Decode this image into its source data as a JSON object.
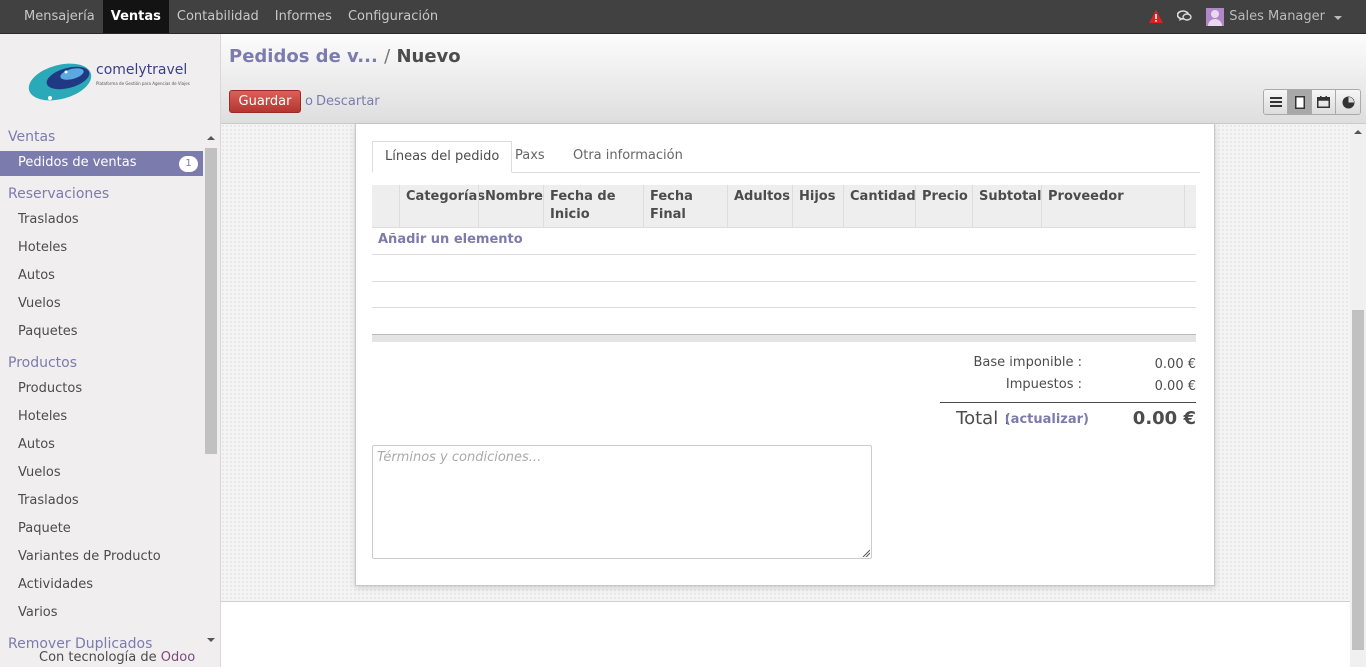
{
  "topbar": {
    "menu": [
      "Mensajería",
      "Ventas",
      "Contabilidad",
      "Informes",
      "Configuración"
    ],
    "active_index": 1,
    "user": "Sales Manager"
  },
  "sidebar": {
    "logo_title": "comelytravel",
    "logo_subtitle": "Plataforma de Gestión para Agencias de Viajes",
    "sections": [
      {
        "label": "Ventas",
        "items": [
          {
            "label": "Pedidos de ventas",
            "badge": "1",
            "active": true
          }
        ]
      },
      {
        "label": "Reservaciones",
        "items": [
          "Traslados",
          "Hoteles",
          "Autos",
          "Vuelos",
          "Paquetes"
        ]
      },
      {
        "label": "Productos",
        "items": [
          "Productos",
          "Hoteles",
          "Autos",
          "Vuelos",
          "Traslados",
          "Paquete",
          "Variantes de Producto",
          "Actividades",
          "Varios"
        ]
      },
      {
        "label": "Remover Duplicados",
        "items": []
      }
    ],
    "powered_prefix": "Con tecnología de",
    "powered_brand": "Odoo"
  },
  "header": {
    "breadcrumb_parent": "Pedidos de v...",
    "breadcrumb_sep": "/",
    "breadcrumb_current": "Nuevo",
    "save_label": "Guardar",
    "or_label": "o",
    "discard_label": "Descartar",
    "views": [
      "list-view-icon",
      "form-view-icon",
      "calendar-view-icon",
      "graph-view-icon"
    ]
  },
  "form": {
    "tabs": [
      "Líneas del pedido",
      "Paxs",
      "Otra información"
    ],
    "active_tab": 0,
    "columns": [
      "Categorías",
      "Nombre",
      "Fecha de Inicio",
      "Fecha Final",
      "Adultos",
      "Hijos",
      "Cantidad",
      "Precio",
      "Subtotal",
      "Proveedor"
    ],
    "add_item": "Añadir un elemento",
    "totals": {
      "base_label": "Base imponible :",
      "base_value": "0.00 €",
      "tax_label": "Impuestos :",
      "tax_value": "0.00 €",
      "total_label": "Total :",
      "update_label": "(actualizar)",
      "total_value": "0.00 €"
    },
    "terms_placeholder": "Términos y condiciones..."
  },
  "colors": {
    "accent": "#7c7bad",
    "topbar": "#414141",
    "save_button": "#c53a34"
  }
}
